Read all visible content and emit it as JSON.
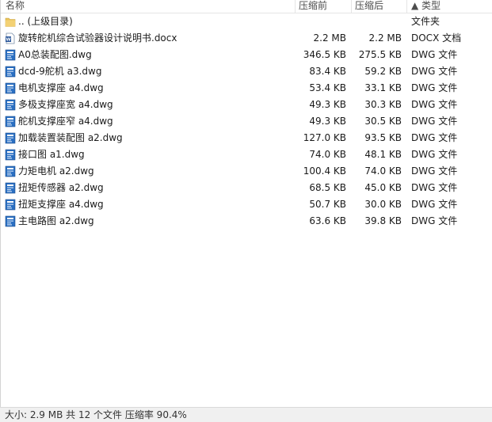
{
  "columns": {
    "name": "名称",
    "packed": "压缩前",
    "size": "压缩后",
    "type": "▲ 类型"
  },
  "rows": [
    {
      "name": ".. (上级目录)",
      "packed": "",
      "size": "",
      "type": "文件夹",
      "icon": "folder-icon"
    },
    {
      "name": "旋转舵机综合试验器设计说明书.docx",
      "packed": "2.2 MB",
      "size": "2.2 MB",
      "type": "DOCX 文档",
      "icon": "word-document-icon"
    },
    {
      "name": "A0总装配图.dwg",
      "packed": "346.5 KB",
      "size": "275.5 KB",
      "type": "DWG 文件",
      "icon": "dwg-file-icon"
    },
    {
      "name": "dcd-9舵机 a3.dwg",
      "packed": "83.4 KB",
      "size": "59.2 KB",
      "type": "DWG 文件",
      "icon": "dwg-file-icon"
    },
    {
      "name": "电机支撑座 a4.dwg",
      "packed": "53.4 KB",
      "size": "33.1 KB",
      "type": "DWG 文件",
      "icon": "dwg-file-icon"
    },
    {
      "name": "多极支撑座宽 a4.dwg",
      "packed": "49.3 KB",
      "size": "30.3 KB",
      "type": "DWG 文件",
      "icon": "dwg-file-icon"
    },
    {
      "name": "舵机支撑座窄 a4.dwg",
      "packed": "49.3 KB",
      "size": "30.5 KB",
      "type": "DWG 文件",
      "icon": "dwg-file-icon"
    },
    {
      "name": "加载装置装配图 a2.dwg",
      "packed": "127.0 KB",
      "size": "93.5 KB",
      "type": "DWG 文件",
      "icon": "dwg-file-icon"
    },
    {
      "name": "接口图 a1.dwg",
      "packed": "74.0 KB",
      "size": "48.1 KB",
      "type": "DWG 文件",
      "icon": "dwg-file-icon"
    },
    {
      "name": "力矩电机 a2.dwg",
      "packed": "100.4 KB",
      "size": "74.0 KB",
      "type": "DWG 文件",
      "icon": "dwg-file-icon"
    },
    {
      "name": "扭矩传感器 a2.dwg",
      "packed": "68.5 KB",
      "size": "45.0 KB",
      "type": "DWG 文件",
      "icon": "dwg-file-icon"
    },
    {
      "name": "扭矩支撑座 a4.dwg",
      "packed": "50.7 KB",
      "size": "30.0 KB",
      "type": "DWG 文件",
      "icon": "dwg-file-icon"
    },
    {
      "name": "主电路图 a2.dwg",
      "packed": "63.6 KB",
      "size": "39.8 KB",
      "type": "DWG 文件",
      "icon": "dwg-file-icon"
    }
  ],
  "status": {
    "text": "大小: 2.9 MB 共 12 个文件 压缩率 90.4%"
  },
  "colors": {
    "folder": "#e8c25a",
    "dwg": "#2a6fc2",
    "doc": "#2b579a"
  }
}
